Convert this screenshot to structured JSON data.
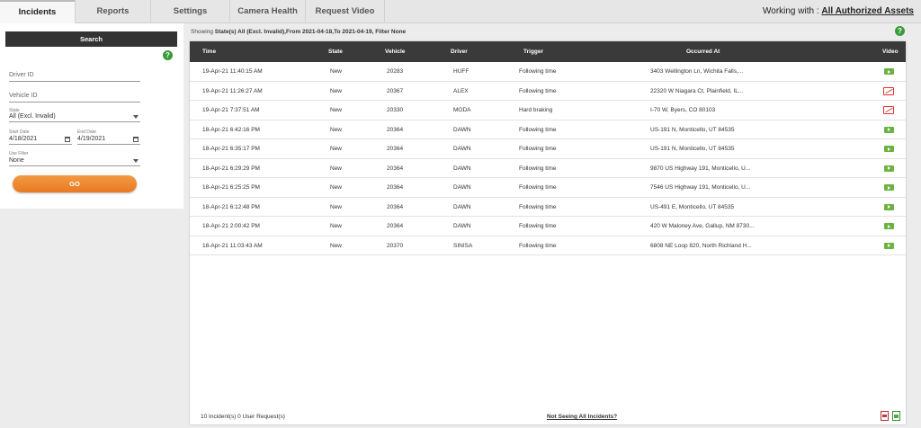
{
  "tabs": [
    {
      "label": "Incidents",
      "active": true
    },
    {
      "label": "Reports"
    },
    {
      "label": "Settings"
    },
    {
      "label": "Camera Health"
    },
    {
      "label": "Request Video"
    }
  ],
  "working_with": {
    "prefix": "Working with : ",
    "value": "All Authorized Assets"
  },
  "search": {
    "header": "Search",
    "driver_id_placeholder": "Driver ID",
    "vehicle_id_placeholder": "Vehicle ID",
    "state_label": "State",
    "state_value": "All (Excl. Invalid)",
    "start_date_label": "Start Date",
    "start_date_value": "4/18/2021",
    "end_date_label": "End Date",
    "end_date_value": "4/19/2021",
    "filter_label": "Use Filter",
    "filter_value": "None",
    "go_label": "GO"
  },
  "showing": {
    "prefix": "Showing ",
    "value": "State(s) All (Excl. Invalid),From 2021-04-18,To 2021-04-19, Filter None"
  },
  "table": {
    "headers": {
      "time": "Time",
      "state": "State",
      "vehicle": "Vehicle",
      "driver": "Driver",
      "trigger": "Trigger",
      "occurred_at": "Occurred At",
      "video": "Video"
    },
    "rows": [
      {
        "time": "19-Apr-21 11:40:15 AM",
        "state": "New",
        "vehicle": "20283",
        "driver": "HUFF",
        "trigger": "Following time",
        "occurred_at": "3403 Wellington Ln, Wichita Falls,...",
        "video": "available"
      },
      {
        "time": "19-Apr-21 11:26:27 AM",
        "state": "New",
        "vehicle": "20367",
        "driver": "ALEX",
        "trigger": "Following time",
        "occurred_at": "22320 W Niagara Ct, Plainfield, IL...",
        "video": "unavailable"
      },
      {
        "time": "19-Apr-21 7:37:51 AM",
        "state": "New",
        "vehicle": "20330",
        "driver": "MODA",
        "trigger": "Hard braking",
        "occurred_at": "I-70 W, Byers, CO 80103",
        "video": "unavailable"
      },
      {
        "time": "18-Apr-21 6:42:16 PM",
        "state": "New",
        "vehicle": "20364",
        "driver": "DAWN",
        "trigger": "Following time",
        "occurred_at": "US-191 N, Monticello, UT 84535",
        "video": "available"
      },
      {
        "time": "18-Apr-21 6:35:17 PM",
        "state": "New",
        "vehicle": "20364",
        "driver": "DAWN",
        "trigger": "Following time",
        "occurred_at": "US-191 N, Monticello, UT 84535",
        "video": "available"
      },
      {
        "time": "18-Apr-21 6:29:29 PM",
        "state": "New",
        "vehicle": "20364",
        "driver": "DAWN",
        "trigger": "Following time",
        "occurred_at": "9870 US Highway 191, Monticello, U...",
        "video": "available"
      },
      {
        "time": "18-Apr-21 6:25:25 PM",
        "state": "New",
        "vehicle": "20364",
        "driver": "DAWN",
        "trigger": "Following time",
        "occurred_at": "7546 US Highway 191, Monticello, U...",
        "video": "available"
      },
      {
        "time": "18-Apr-21 6:12:48 PM",
        "state": "New",
        "vehicle": "20364",
        "driver": "DAWN",
        "trigger": "Following time",
        "occurred_at": "US-491 E, Monticello, UT 84535",
        "video": "available"
      },
      {
        "time": "18-Apr-21 2:00:42 PM",
        "state": "New",
        "vehicle": "20364",
        "driver": "DAWN",
        "trigger": "Following time",
        "occurred_at": "420 W Maloney Ave, Gallup, NM 8730...",
        "video": "available"
      },
      {
        "time": "18-Apr-21 11:03:43 AM",
        "state": "New",
        "vehicle": "20370",
        "driver": "SINISA",
        "trigger": "Following time",
        "occurred_at": "6808 NE Loop 820, North Richland H...",
        "video": "available"
      }
    ]
  },
  "footer": {
    "count": "10 Incident(s) 0 User Request(s)",
    "link": "Not Seeing All Incidents?"
  },
  "icons": {
    "help": "help-icon",
    "play": "play-video-icon",
    "no_video": "no-video-icon",
    "pdf": "pdf-export-icon",
    "excel": "excel-export-icon"
  },
  "colors": {
    "accent": "#e87a22",
    "header": "#3a3a3a",
    "help": "#3a9b3a",
    "video": "#6bb33f",
    "no_video": "#dd3333"
  }
}
